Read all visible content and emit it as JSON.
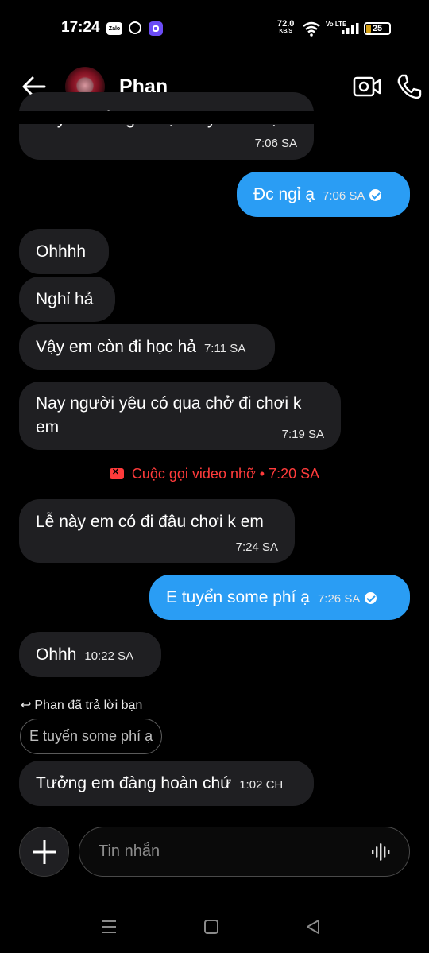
{
  "status_bar": {
    "time": "17:24",
    "zalo": "Zalo",
    "speed_value": "72.0",
    "speed_unit": "KB/S",
    "network": "Vo LTE",
    "battery": "25"
  },
  "header": {
    "contact_name": "Phan",
    "icons": [
      "back-arrow-icon",
      "video-call-icon",
      "phone-call-icon"
    ]
  },
  "messages": [
    {
      "id": "m0",
      "side": "in",
      "text": "Nay em nồng đi học nay đi làm ạ",
      "time": "7:06 SA"
    },
    {
      "id": "m1",
      "side": "out",
      "text": "Đc ngỉ ạ",
      "time": "7:06 SA"
    },
    {
      "id": "m2",
      "side": "in",
      "text": "Ohhhh"
    },
    {
      "id": "m3",
      "side": "in",
      "text": "Nghỉ hả"
    },
    {
      "id": "m4",
      "side": "in",
      "text": "Vậy em còn đi học hả",
      "time": "7:11 SA"
    },
    {
      "id": "m5",
      "side": "in",
      "text_line1": "Nay người yêu có qua chở đi chơi k",
      "text_line2": "em",
      "time": "7:19 SA"
    },
    {
      "id": "m6",
      "side": "in",
      "text": "Lễ này em có đi đâu chơi k em",
      "time": "7:24 SA"
    },
    {
      "id": "m7",
      "side": "out",
      "text": "E tuyển some phí ạ",
      "time": "7:26 SA"
    },
    {
      "id": "m8",
      "side": "in",
      "text": "Ohhh",
      "time": "10:22 SA"
    },
    {
      "id": "m9",
      "side": "in",
      "text": "Tưởng em đàng hoàn chứ",
      "time": "1:02 CH"
    }
  ],
  "missed_call": "Cuộc gọi video nhỡ • 7:20 SA",
  "reply": {
    "label": "Phan đã trả lời bạn",
    "quoted": "E tuyển some phí ạ"
  },
  "composer": {
    "placeholder": "Tin nhắn"
  },
  "colors": {
    "outgoing_bubble": "#2a9df4",
    "incoming_bubble": "#1f1f22",
    "missed_call": "#ff3b3b",
    "background": "#000000"
  }
}
